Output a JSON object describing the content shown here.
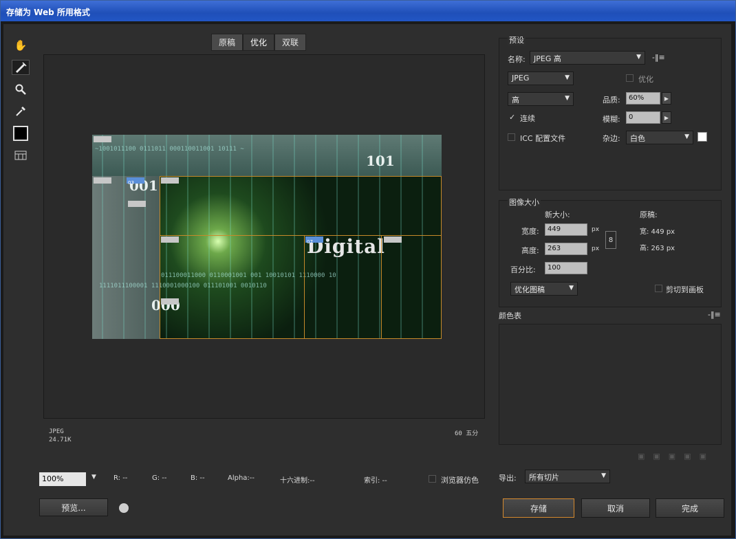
{
  "title": "存储为 Web 所用格式",
  "tabs": [
    "原稿",
    "优化",
    "双联"
  ],
  "active_tab": 1,
  "tools": [
    "hand-icon",
    "slice-select-icon",
    "zoom-icon",
    "eyedropper-icon",
    "color-swatch",
    "slice-visibility-icon"
  ],
  "preview": {
    "text_main": "Digital",
    "num1": "101",
    "num2": "001",
    "num3": "000",
    "badge_label_1": "03",
    "badge_label_2": "07"
  },
  "status": {
    "format": "JPEG",
    "size": "24.71K",
    "speed": "60 五分"
  },
  "bottom": {
    "zoom": "100%",
    "r_label": "R: --",
    "g_label": "G: --",
    "b_label": "B: --",
    "alpha_label": "Alpha:--",
    "hex_label": "十六进制:--",
    "index_label": "索引: --",
    "browser_dither": "浏览器仿色",
    "preview_button": "预览...",
    "browser_icon": "browser-icon"
  },
  "preset": {
    "section_title": "预设",
    "name_label": "名称:",
    "name_value": "JPEG 高",
    "format_value": "JPEG",
    "optimized_label": "优化",
    "quality_preset": "高",
    "quality_label": "品质:",
    "quality_value": "60%",
    "progressive_label": "连续",
    "blur_label": "模糊:",
    "blur_value": "0",
    "icc_label": "ICC 配置文件",
    "matte_label": "杂边:",
    "matte_value": "白色"
  },
  "image_size": {
    "section_title": "图像大小",
    "new_size_label": "新大小:",
    "width_label": "宽度:",
    "width_value": "449",
    "height_label": "高度:",
    "height_value": "263",
    "px_unit": "px",
    "percent_label": "百分比:",
    "percent_value": "100",
    "original_label": "原稿:",
    "orig_width": "宽: 449 px",
    "orig_height": "高: 263 px",
    "quality_mode": "优化图稿",
    "clip_label": "剪切到画板"
  },
  "color_table": {
    "section_title": "颜色表"
  },
  "export": {
    "label": "导出:",
    "value": "所有切片"
  },
  "buttons": {
    "save": "存储",
    "cancel": "取消",
    "done": "完成"
  }
}
